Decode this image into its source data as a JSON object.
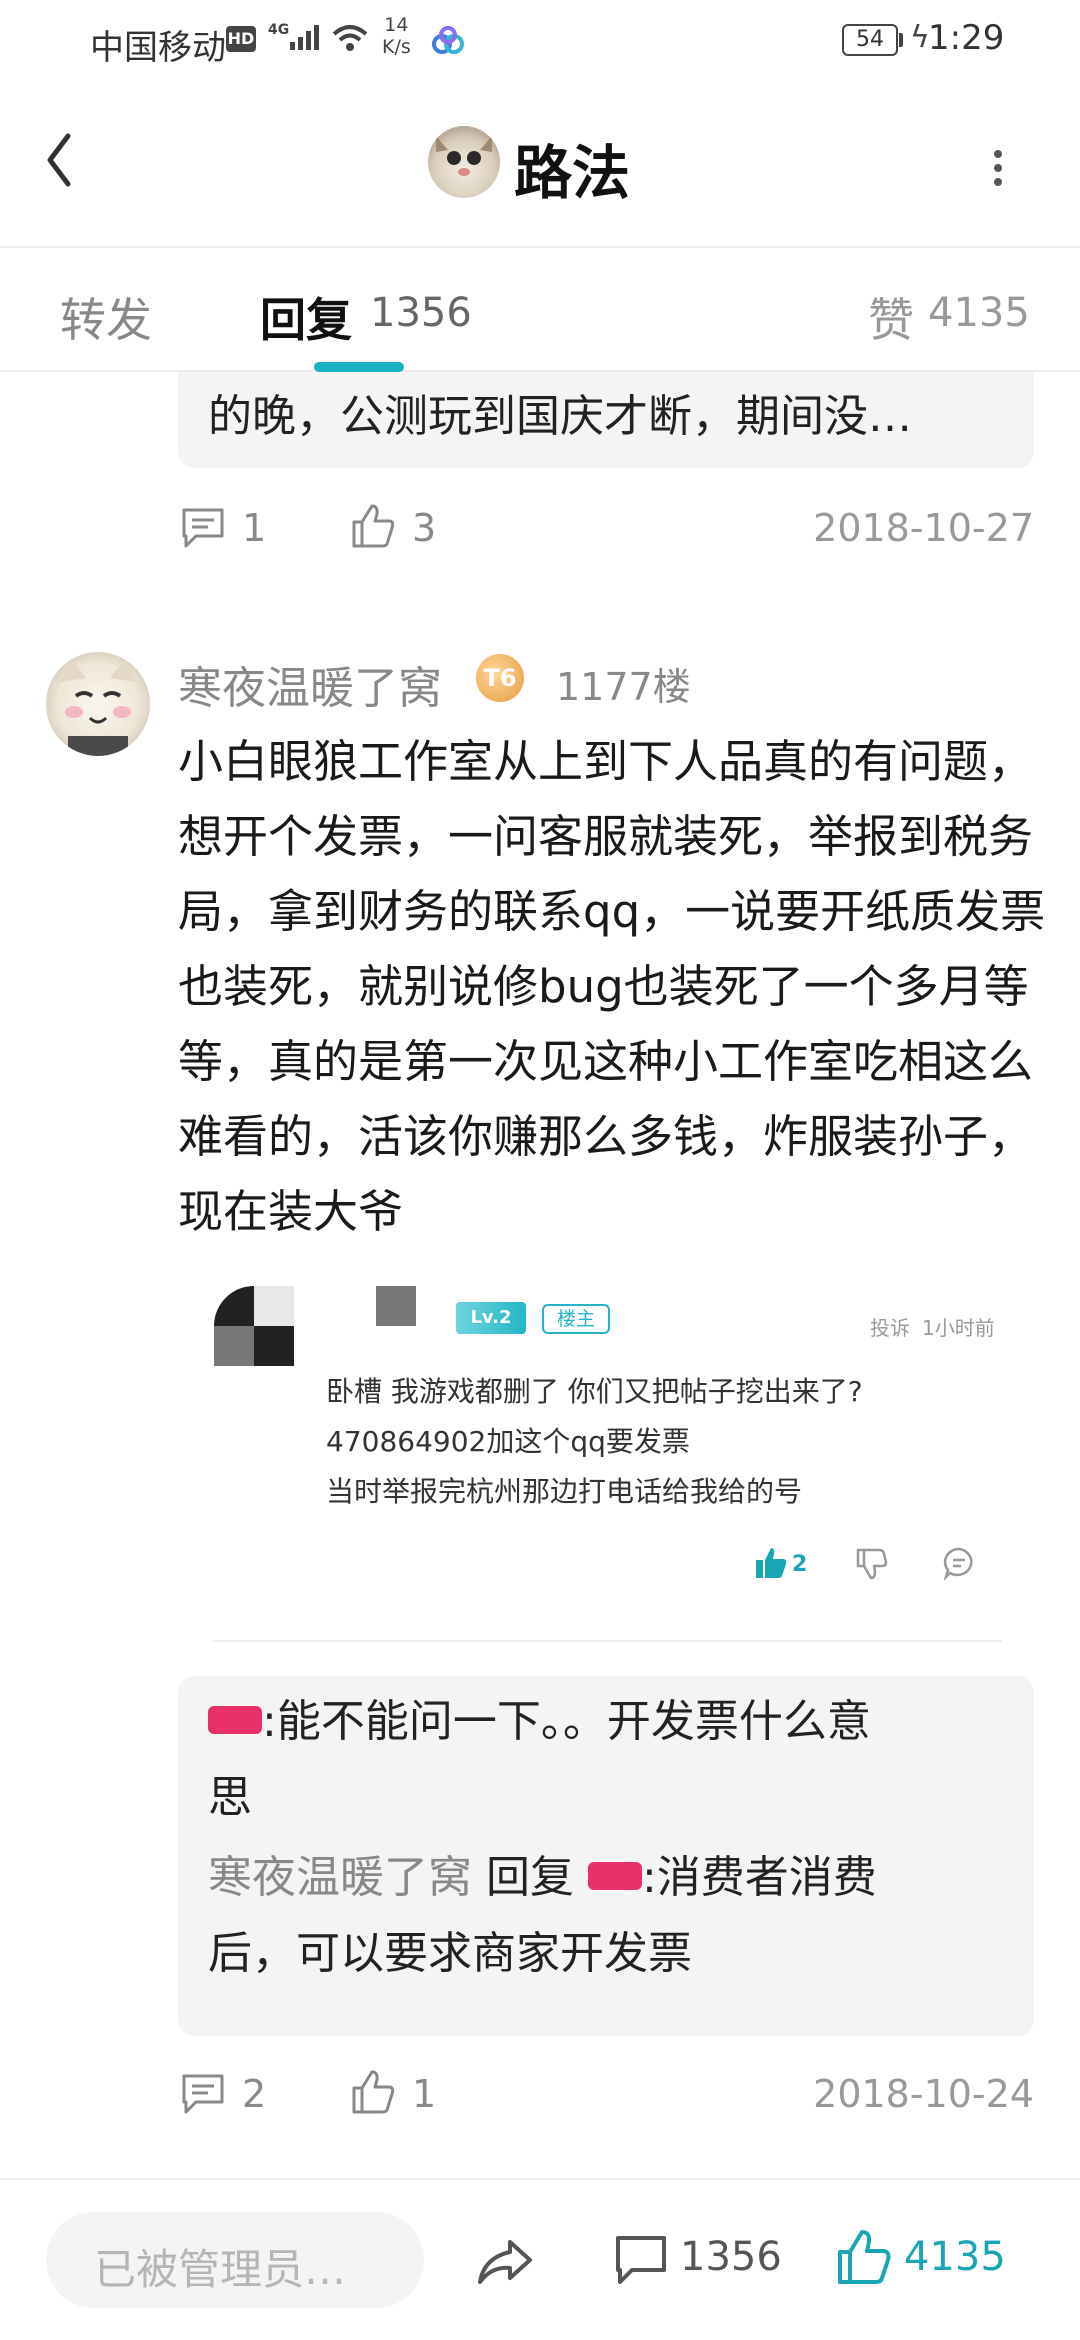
{
  "status_bar": {
    "carrier": "中国移动",
    "hd": "HD",
    "network": "4G",
    "speed_value": "14",
    "speed_unit": "K/s",
    "battery": "54",
    "time": "1:29"
  },
  "header": {
    "title": "路法"
  },
  "tabs": {
    "repost": "转发",
    "reply": "回复",
    "reply_count": "1356",
    "likes": "赞",
    "likes_count": "4135"
  },
  "prev_comment": {
    "quote_text": "的晚，公测玩到国庆才断，期间没…",
    "comment_count": "1",
    "like_count": "3",
    "date": "2018-10-27"
  },
  "comment": {
    "username": "寒夜温暖了窝",
    "badge": "T6",
    "floor": "1177楼",
    "body": "小白眼狼工作室从上到下人品真的有问题，想开个发票，一问客服就装死，举报到税务局，拿到财务的联系qq，一说要开纸质发票也装死，就别说修bug也装死了一个多月等等，真的是第一次见这种小工作室吃相这么难看的，活该你赚那么多钱，炸服装孙子，现在装大爷",
    "embed": {
      "level": "Lv.2",
      "poster_tag": "楼主",
      "report": "投诉",
      "time": "1小时前",
      "lines": [
        "卧槽 我游戏都删了 你们又把帖子挖出来了?",
        "470864902加这个qq要发票",
        "当时举报完杭州那边打电话给我给的号"
      ],
      "like_count": "2"
    },
    "replies": [
      {
        "text_line1": ":能不能问一下。。开发票什么意",
        "text_line2": "思"
      },
      {
        "user": "寒夜温暖了窝",
        "reply_word": " 回复 ",
        "text_line1": ":消费者消费",
        "text_line2": "后，可以要求商家开发票"
      }
    ],
    "comment_count": "2",
    "like_count": "1",
    "date": "2018-10-24"
  },
  "bottom_bar": {
    "input_placeholder": "已被管理员…",
    "comment_count": "1356",
    "like_count": "4135"
  },
  "colors": {
    "accent": "#17b1c1",
    "ticket": "#e8306a",
    "quote_bg": "#f4f4f4"
  }
}
